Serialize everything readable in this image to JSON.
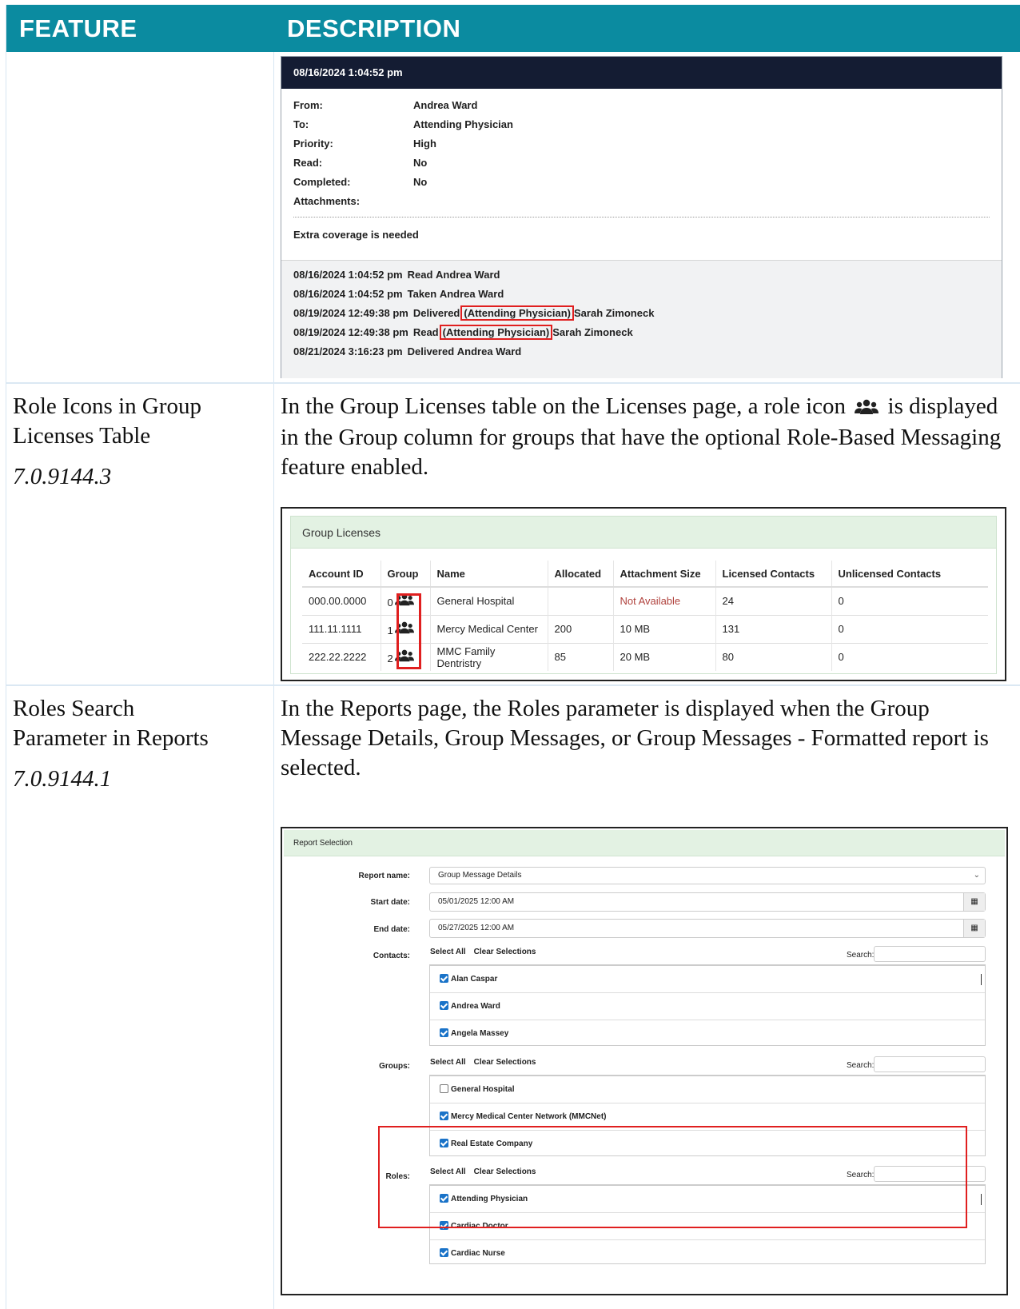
{
  "header": {
    "feature": "FEATURE",
    "description": "DESCRIPTION"
  },
  "message": {
    "timestamp": "08/16/2024 1:04:52 pm",
    "fields": [
      {
        "label": "From:",
        "value": "Andrea Ward"
      },
      {
        "label": "To:",
        "value": "Attending Physician"
      },
      {
        "label": "Priority:",
        "value": "High"
      },
      {
        "label": "Read:",
        "value": "No"
      },
      {
        "label": "Completed:",
        "value": "No"
      },
      {
        "label": "Attachments:",
        "value": ""
      }
    ],
    "body": "Extra coverage is needed",
    "history": [
      {
        "ts": "08/16/2024 1:04:52 pm",
        "action": "Read",
        "role": "",
        "who": "Andrea Ward"
      },
      {
        "ts": "08/16/2024 1:04:52 pm",
        "action": "Taken",
        "role": "",
        "who": "Andrea Ward"
      },
      {
        "ts": "08/19/2024 12:49:38 pm",
        "action": "Delivered",
        "role": "(Attending Physician)",
        "who": "Sarah Zimoneck"
      },
      {
        "ts": "08/19/2024 12:49:38 pm",
        "action": "Read",
        "role": "(Attending Physician)",
        "who": "Sarah Zimoneck"
      },
      {
        "ts": "08/21/2024 3:16:23 pm",
        "action": "Delivered",
        "role": "",
        "who": "Andrea Ward"
      }
    ]
  },
  "row_role_icons": {
    "title_line1": "Role Icons in Group",
    "title_line2": "Licenses Table",
    "version": "7.0.9144.3",
    "text_part1": "In the Group Licenses table on the Licenses page, a role icon",
    "text_part2": "is displayed in the Group column for groups that have the optional Role-Based Messaging feature enabled.",
    "icon": "users-group-icon"
  },
  "group_licenses": {
    "title": "Group Licenses",
    "columns": [
      "Account ID",
      "Group",
      "Name",
      "Allocated",
      "Attachment Size",
      "Licensed Contacts",
      "Unlicensed Contacts"
    ],
    "rows": [
      {
        "account": "000.00.0000",
        "group": "0",
        "name": "General Hospital",
        "allocated": "",
        "attachment": "Not Available",
        "licensed": "24",
        "unlicensed": "0"
      },
      {
        "account": "111.11.1111",
        "group": "1",
        "name": "Mercy Medical Center",
        "allocated": "200",
        "attachment": "10 MB",
        "licensed": "131",
        "unlicensed": "0"
      },
      {
        "account": "222.22.2222",
        "group": "2",
        "name": "MMC Family Dentristry",
        "allocated": "85",
        "attachment": "20 MB",
        "licensed": "80",
        "unlicensed": "0"
      }
    ]
  },
  "row_roles_search": {
    "title_line1": "Roles Search",
    "title_line2": "Parameter in Reports",
    "version": "7.0.9144.1",
    "text": "In the Reports page, the Roles parameter is displayed when the Group Message Details, Group Messages, or Group Messages - Formatted report is selected."
  },
  "report_selection": {
    "title": "Report Selection",
    "report_name_label": "Report name:",
    "report_name_value": "Group Message Details",
    "start_label": "Start date:",
    "start_value": "05/01/2025 12:00 AM",
    "end_label": "End date:",
    "end_value": "05/27/2025 12:00 AM",
    "select_all": "Select All",
    "clear": "Clear Selections",
    "search_label": "Search:",
    "contacts_label": "Contacts:",
    "contacts": [
      {
        "name": "Alan Caspar",
        "checked": true
      },
      {
        "name": "Andrea Ward",
        "checked": true
      },
      {
        "name": "Angela Massey",
        "checked": true
      }
    ],
    "groups_label": "Groups:",
    "groups": [
      {
        "name": "General Hospital",
        "checked": false
      },
      {
        "name": "Mercy Medical Center Network (MMCNet)",
        "checked": true
      },
      {
        "name": "Real Estate Company",
        "checked": true
      }
    ],
    "roles_label": "Roles:",
    "roles": [
      {
        "name": "Attending Physician",
        "checked": true
      },
      {
        "name": "Cardiac Doctor",
        "checked": true
      },
      {
        "name": "Cardiac Nurse",
        "checked": true
      }
    ]
  },
  "colors": {
    "header_bg": "#0b8ba0",
    "highlight": "#e01f1f",
    "panel_head": "#141c33",
    "green_head": "#e3f2e3"
  }
}
